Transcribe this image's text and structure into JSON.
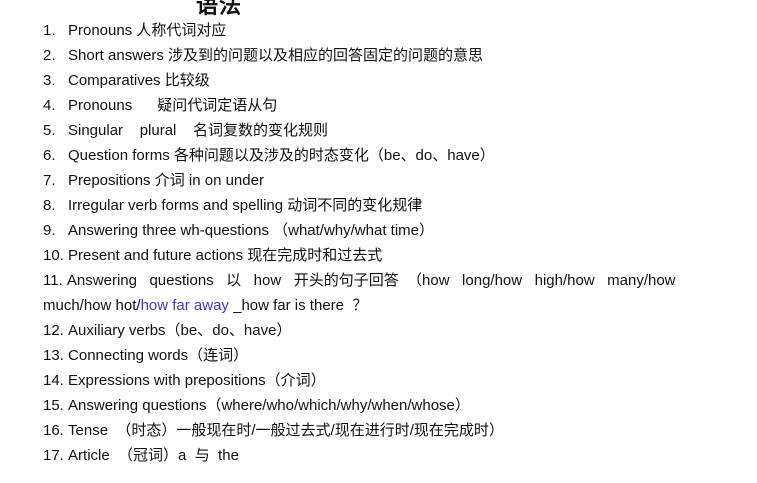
{
  "heading": "语法",
  "items": [
    {
      "num": "1.",
      "text": "Pronouns  人称代词对应"
    },
    {
      "num": "2.",
      "text": "Short answers  涉及到的问题以及相应的回答固定的问题的意思"
    },
    {
      "num": "3.",
      "text": "Comparatives  比较级"
    },
    {
      "num": "4.",
      "text": "Pronouns      疑问代词定语从句"
    },
    {
      "num": "5.",
      "text": "Singular    plural    名词复数的变化规则"
    },
    {
      "num": "6.",
      "text": "Question forms  各种问题以及涉及的时态变化（be、do、have）"
    },
    {
      "num": "7.",
      "text": "Prepositions  介词 in on under"
    },
    {
      "num": "8.",
      "text": "Irregular verb forms and spelling  动词不同的变化规律"
    },
    {
      "num": "9.",
      "text": "Answering three wh-questions  （what/why/what time）"
    },
    {
      "num": "10.",
      "text": "Present and future actions  现在完成时和过去式"
    },
    {
      "num": "11.",
      "line1": "Answering   questions   以   how   开头的句子回答  （how   long/how   high/how   many/how",
      "line2_a": "much/how hot/",
      "line2_link": "how far away",
      "line2_b": " _how far is there  ？"
    },
    {
      "num": "12.",
      "text": "Auxiliary verbs（be、do、have）"
    },
    {
      "num": "13.",
      "text": "Connecting words（连词）"
    },
    {
      "num": "14.",
      "text": "Expressions with prepositions（介词）"
    },
    {
      "num": "15.",
      "text": "Answering questions（where/who/which/why/when/whose）"
    },
    {
      "num": "16.",
      "text": "Tense  （时态）一般现在时/一般过去式/现在进行时/现在完成时）"
    },
    {
      "num": "17.",
      "text": "Article  （冠词）a  与  the"
    }
  ],
  "colors": {
    "text": "#111111",
    "link": "#3b3bd6"
  }
}
